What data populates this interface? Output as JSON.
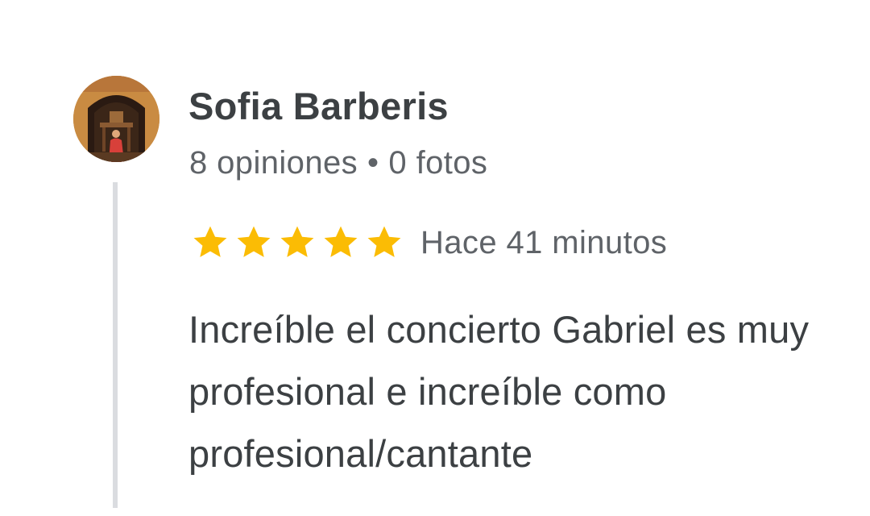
{
  "review": {
    "author": {
      "name": "Sofia Barberis",
      "reviews_count": "8 opiniones",
      "separator": "•",
      "photos_count": "0 fotos",
      "avatar_icon": "user-photo-avatar"
    },
    "rating": {
      "stars": 5,
      "max_stars": 5,
      "star_color": "#fbbc04",
      "star_icon": "star-icon"
    },
    "timestamp": "Hace 41 minutos",
    "text": "Increíble el concierto Gabriel es muy profesional e increíble como profesional/cantante"
  },
  "colors": {
    "name_text": "#3c4043",
    "meta_text": "#5f6368",
    "thread_line": "#dadce0",
    "background": "#ffffff"
  }
}
